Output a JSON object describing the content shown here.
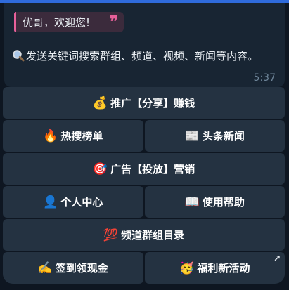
{
  "quote": {
    "text": "优哥，欢迎您!",
    "icon": "quote-icon"
  },
  "message": {
    "icon": "magnifier-icon",
    "text": "发送关键词搜索群组、频道、视频、新闻等内容。",
    "time": "5:37"
  },
  "keyboard": {
    "rows": [
      [
        {
          "emoji": "💰",
          "label": "推广【分享】赚钱"
        }
      ],
      [
        {
          "emoji": "🔥",
          "label": "热搜榜单"
        },
        {
          "emoji": "📰",
          "label": "头条新闻"
        }
      ],
      [
        {
          "emoji": "🎯",
          "label": "广告【投放】营销"
        }
      ],
      [
        {
          "emoji": "👤",
          "label": "个人中心"
        },
        {
          "emoji": "📖",
          "label": "使用帮助"
        }
      ],
      [
        {
          "emoji": "💯",
          "label": "频道群组目录"
        }
      ],
      [
        {
          "emoji": "✍️",
          "label": "签到领现金"
        },
        {
          "emoji": "🥳",
          "label": "福利新活动",
          "corner_icon": "↗"
        }
      ]
    ]
  }
}
